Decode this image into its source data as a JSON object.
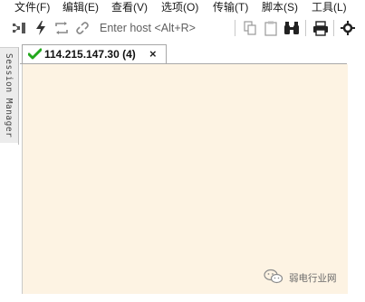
{
  "menubar": {
    "items": [
      "文件(F)",
      "编辑(E)",
      "查看(V)",
      "选项(O)",
      "传输(T)",
      "脚本(S)",
      "工具(L)"
    ]
  },
  "toolbar": {
    "icons": [
      "connect-icon",
      "quick-connect-icon",
      "reconnect-icon",
      "disconnect-icon",
      "copy-icon",
      "paste-icon",
      "find-icon",
      "print-icon",
      "settings-icon"
    ],
    "host_placeholder": "Enter host <Alt+R>"
  },
  "sidebar": {
    "label": "Session Manager"
  },
  "tabs": [
    {
      "title": "114.215.147.30 (4)",
      "status": "connected",
      "status_color": "#22a81c",
      "close_glyph": "×"
    }
  ],
  "terminal": {
    "background": "#fdf3e3"
  },
  "watermark": {
    "text": "弱电行业网"
  }
}
